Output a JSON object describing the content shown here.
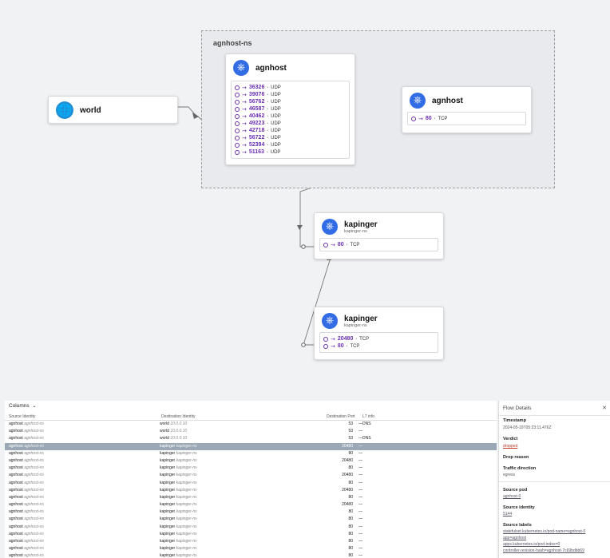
{
  "graph": {
    "namespace_label": "agnhost-ns",
    "world": {
      "title": "world",
      "icon": "globe-icon"
    },
    "agnhost_src": {
      "title": "agnhost",
      "icon": "kubernetes-icon",
      "ports": [
        {
          "port": "36326",
          "proto": "UDP"
        },
        {
          "port": "39076",
          "proto": "UDP"
        },
        {
          "port": "56762",
          "proto": "UDP"
        },
        {
          "port": "46587",
          "proto": "UDP"
        },
        {
          "port": "40462",
          "proto": "UDP"
        },
        {
          "port": "49223",
          "proto": "UDP"
        },
        {
          "port": "42718",
          "proto": "UDP"
        },
        {
          "port": "56722",
          "proto": "UDP"
        },
        {
          "port": "52394",
          "proto": "UDP"
        },
        {
          "port": "51163",
          "proto": "UDP"
        }
      ]
    },
    "agnhost_dst": {
      "title": "agnhost",
      "icon": "kubernetes-icon",
      "ports": [
        {
          "port": "80",
          "proto": "TCP"
        }
      ]
    },
    "kapinger_1": {
      "title": "kapinger",
      "subtitle": "kapinger-ns",
      "icon": "kubernetes-icon",
      "ports": [
        {
          "port": "80",
          "proto": "TCP"
        }
      ]
    },
    "kapinger_2": {
      "title": "kapinger",
      "subtitle": "kapinger-ns",
      "icon": "kubernetes-icon",
      "ports": [
        {
          "port": "20480",
          "proto": "TCP"
        },
        {
          "port": "80",
          "proto": "TCP"
        }
      ]
    }
  },
  "table": {
    "columns_button": "Columns",
    "headers": {
      "source": "Source Identity",
      "dest": "Destination Identity",
      "port": "Destination Port",
      "l7": "L7 info"
    },
    "rows": [
      {
        "src": "agnhost",
        "src_ns": "agnhost-ns",
        "dst": "world",
        "dst_ns": "10.0.0.10",
        "port": "53",
        "l7": "—DNS",
        "selected": false
      },
      {
        "src": "agnhost",
        "src_ns": "agnhost-ns",
        "dst": "world",
        "dst_ns": "10.0.0.10",
        "port": "53",
        "l7": "—",
        "selected": false
      },
      {
        "src": "agnhost",
        "src_ns": "agnhost-ns",
        "dst": "world",
        "dst_ns": "10.0.0.10",
        "port": "53",
        "l7": "—DNS",
        "selected": false
      },
      {
        "src": "agnhost",
        "src_ns": "agnhost-ns",
        "dst": "kapinger",
        "dst_ns": "kapinger-ns",
        "port": "20480",
        "l7": "—",
        "selected": true
      },
      {
        "src": "agnhost",
        "src_ns": "agnhost-ns",
        "dst": "kapinger",
        "dst_ns": "kapinger-ns",
        "port": "80",
        "l7": "—",
        "selected": false
      },
      {
        "src": "agnhost",
        "src_ns": "agnhost-ns",
        "dst": "kapinger",
        "dst_ns": "kapinger-ns",
        "port": "20480",
        "l7": "—",
        "selected": false
      },
      {
        "src": "agnhost",
        "src_ns": "agnhost-ns",
        "dst": "kapinger",
        "dst_ns": "kapinger-ns",
        "port": "80",
        "l7": "—",
        "selected": false
      },
      {
        "src": "agnhost",
        "src_ns": "agnhost-ns",
        "dst": "kapinger",
        "dst_ns": "kapinger-ns",
        "port": "20480",
        "l7": "—",
        "selected": false
      },
      {
        "src": "agnhost",
        "src_ns": "agnhost-ns",
        "dst": "kapinger",
        "dst_ns": "kapinger-ns",
        "port": "80",
        "l7": "—",
        "selected": false
      },
      {
        "src": "agnhost",
        "src_ns": "agnhost-ns",
        "dst": "kapinger",
        "dst_ns": "kapinger-ns",
        "port": "20480",
        "l7": "—",
        "selected": false
      },
      {
        "src": "agnhost",
        "src_ns": "agnhost-ns",
        "dst": "kapinger",
        "dst_ns": "kapinger-ns",
        "port": "80",
        "l7": "—",
        "selected": false
      },
      {
        "src": "agnhost",
        "src_ns": "agnhost-ns",
        "dst": "kapinger",
        "dst_ns": "kapinger-ns",
        "port": "20480",
        "l7": "—",
        "selected": false
      },
      {
        "src": "agnhost",
        "src_ns": "agnhost-ns",
        "dst": "kapinger",
        "dst_ns": "kapinger-ns",
        "port": "80",
        "l7": "—",
        "selected": false
      },
      {
        "src": "agnhost",
        "src_ns": "agnhost-ns",
        "dst": "kapinger",
        "dst_ns": "kapinger-ns",
        "port": "80",
        "l7": "—",
        "selected": false
      },
      {
        "src": "agnhost",
        "src_ns": "agnhost-ns",
        "dst": "kapinger",
        "dst_ns": "kapinger-ns",
        "port": "80",
        "l7": "—",
        "selected": false
      },
      {
        "src": "agnhost",
        "src_ns": "agnhost-ns",
        "dst": "kapinger",
        "dst_ns": "kapinger-ns",
        "port": "80",
        "l7": "—",
        "selected": false
      },
      {
        "src": "agnhost",
        "src_ns": "agnhost-ns",
        "dst": "kapinger",
        "dst_ns": "kapinger-ns",
        "port": "80",
        "l7": "—",
        "selected": false
      },
      {
        "src": "agnhost",
        "src_ns": "agnhost-ns",
        "dst": "kapinger",
        "dst_ns": "kapinger-ns",
        "port": "80",
        "l7": "—",
        "selected": false
      },
      {
        "src": "agnhost",
        "src_ns": "agnhost-ns",
        "dst": "kapinger",
        "dst_ns": "kapinger-ns",
        "port": "80",
        "l7": "—",
        "selected": false
      }
    ]
  },
  "details": {
    "title": "Flow Details",
    "timestamp_label": "Timestamp",
    "timestamp": "2024-05-19T05:23:11.476Z",
    "verdict_label": "Verdict",
    "verdict": "dropped",
    "drop_reason_label": "Drop reason",
    "traffic_direction_label": "Traffic direction",
    "traffic_direction": "egress",
    "source_pod_label": "Source pod",
    "source_pod": "agnhost-0",
    "source_identity_label": "Source identity",
    "source_identity": "5144",
    "source_labels_label": "Source labels",
    "source_labels": [
      "statefulset.kubernetes.io/pod-name=agnhost-0",
      "app=agnhost",
      "apps.kubernetes.io/pod-index=0",
      "controller-revision-hash=agnhost-7c69bdbb69"
    ],
    "colors": {
      "accent": "#326ce5",
      "port": "#6b2fb3",
      "selected_row": "#9aa8b6",
      "verdict": "#c0392b"
    }
  }
}
